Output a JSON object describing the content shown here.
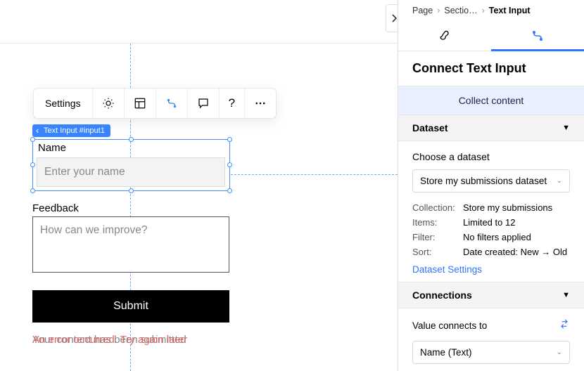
{
  "toolbar": {
    "settings_label": "Settings"
  },
  "canvas": {
    "element_badge": "Text Input #input1",
    "name_label": "Name",
    "name_placeholder": "Enter your name",
    "feedback_label": "Feedback",
    "feedback_placeholder": "How can we improve?",
    "submit_label": "Submit",
    "error_msg": "An error occurred. Try again later",
    "success_msg": "Your content has been submitted"
  },
  "panel": {
    "crumb1": "Page",
    "crumb2": "Sectio…",
    "crumb3": "Text Input",
    "title": "Connect Text Input",
    "collect_label": "Collect content",
    "dataset": {
      "header": "Dataset",
      "choose_label": "Choose a dataset",
      "selected": "Store my submissions dataset",
      "collection_k": "Collection:",
      "collection_v": "Store my submissions",
      "items_k": "Items:",
      "items_v": "Limited to 12",
      "filter_k": "Filter:",
      "filter_v": "No filters applied",
      "sort_k": "Sort:",
      "sort_v": "Date created: New → Old",
      "settings_link": "Dataset Settings"
    },
    "connections": {
      "header": "Connections",
      "value_label": "Value connects to",
      "value_selected": "Name (Text)"
    }
  }
}
